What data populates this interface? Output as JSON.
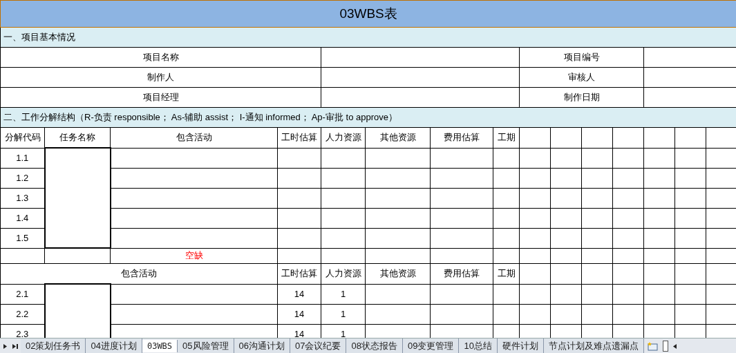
{
  "title": "03WBS表",
  "section1": {
    "heading": "一、项目基本情况",
    "fields": [
      {
        "label": "项目名称",
        "label2": "项目编号"
      },
      {
        "label": "制作人",
        "label2": "审核人"
      },
      {
        "label": "项目经理",
        "label2": "制作日期"
      }
    ]
  },
  "section2": {
    "heading": "二、工作分解结构（R-负责 responsible； As-辅助 assist； I-通知 informed； Ap-审批 to approve）",
    "columns": [
      "分解代码",
      "任务名称",
      "包含活动",
      "工时估算",
      "人力资源",
      "其他资源",
      "费用估算",
      "工期"
    ],
    "group1": [
      {
        "code": "1.1"
      },
      {
        "code": "1.2"
      },
      {
        "code": "1.3"
      },
      {
        "code": "1.4"
      },
      {
        "code": "1.5"
      }
    ],
    "gap_note": "空缺",
    "columns2": [
      "包含活动",
      "工时估算",
      "人力资源",
      "其他资源",
      "费用估算",
      "工期"
    ],
    "group2": [
      {
        "code": "2.1",
        "hours": "14",
        "staff": "1"
      },
      {
        "code": "2.2",
        "hours": "14",
        "staff": "1"
      },
      {
        "code": "2.3",
        "hours": "14",
        "staff": "1"
      }
    ]
  },
  "sheet_tabs": [
    {
      "label": "02策划任务书",
      "selected": false
    },
    {
      "label": "04进度计划",
      "selected": false
    },
    {
      "label": "03WBS",
      "selected": true
    },
    {
      "label": "05风险管理",
      "selected": false
    },
    {
      "label": "06沟通计划",
      "selected": false
    },
    {
      "label": "07会议纪要",
      "selected": false
    },
    {
      "label": "08状态报告",
      "selected": false
    },
    {
      "label": "09变更管理",
      "selected": false
    },
    {
      "label": "10总结",
      "selected": false
    },
    {
      "label": "硬件计划",
      "selected": false
    },
    {
      "label": "节点计划及难点遗漏点",
      "selected": false
    }
  ]
}
